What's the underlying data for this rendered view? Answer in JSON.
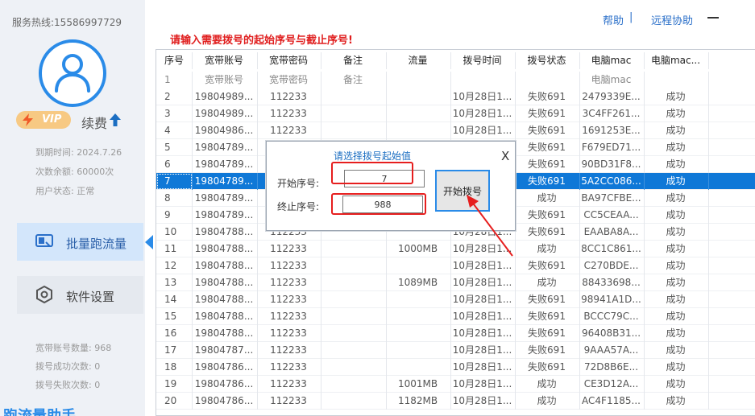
{
  "sidebar": {
    "hotline": "服务热线:15586997729",
    "vip_label": "VIP",
    "renew_label": "续费",
    "expire": "到期时间: 2024.7.26",
    "remaining": "次数余额: 60000次",
    "user_status": "用户状态: 正常",
    "nav_batch": "批量跑流量",
    "nav_settings": "软件设置",
    "stat_accounts": "宽带账号数量: 968",
    "stat_success": "拨号成功次数: 0",
    "stat_fail": "拨号失败次数: 0",
    "brand_partial": "跑流量助手"
  },
  "top": {
    "help": "帮助",
    "separator": "|",
    "remote": "远程协助"
  },
  "instruction": "请输入需要拨号的起始序号与截止序号!",
  "table": {
    "headers": [
      "序号",
      "宽带账号",
      "宽带密码",
      "备注",
      "流量",
      "拨号时间",
      "拨号状态",
      "电脑mac",
      "电脑mac..."
    ],
    "subheader": [
      "1",
      "宽带账号",
      "宽带密码",
      "备注",
      "",
      "",
      "",
      "电脑mac",
      ""
    ],
    "selected_index": 5,
    "rows": [
      [
        "2",
        "19804989...",
        "112233",
        "",
        "",
        "10月28日1...",
        "失败691",
        "2479339E...",
        "成功"
      ],
      [
        "3",
        "19804989...",
        "112233",
        "",
        "",
        "10月28日1...",
        "失败691",
        "3C4FF261...",
        "成功"
      ],
      [
        "4",
        "19804986...",
        "112233",
        "",
        "",
        "10月28日1...",
        "失败691",
        "1691253E...",
        "成功"
      ],
      [
        "5",
        "19804789...",
        "112233",
        "",
        "",
        "",
        "失败691",
        "F679ED71...",
        "成功"
      ],
      [
        "6",
        "19804789...",
        "112233",
        "",
        "",
        "",
        "失败691",
        "90BD31F8...",
        "成功"
      ],
      [
        "7",
        "19804789...",
        "112233",
        "",
        "",
        "",
        "失败691",
        "5A2CC086...",
        "成功"
      ],
      [
        "8",
        "19804789...",
        "112233",
        "",
        "",
        "",
        "成功",
        "BA97CFBE...",
        "成功"
      ],
      [
        "9",
        "19804789...",
        "112233",
        "",
        "",
        "",
        "失败691",
        "CC5CEAA...",
        "成功"
      ],
      [
        "10",
        "19804788...",
        "112233",
        "",
        "",
        "10月28日1...",
        "失败691",
        "EAABA8A...",
        "成功"
      ],
      [
        "11",
        "19804788...",
        "112233",
        "",
        "1000MB",
        "10月28日1...",
        "成功",
        "8CC1C861...",
        "成功"
      ],
      [
        "12",
        "19804788...",
        "112233",
        "",
        "",
        "10月28日1...",
        "失败691",
        "C270BDE...",
        "成功"
      ],
      [
        "13",
        "19804788...",
        "112233",
        "",
        "1089MB",
        "10月28日1...",
        "成功",
        "88433698...",
        "成功"
      ],
      [
        "14",
        "19804788...",
        "112233",
        "",
        "",
        "10月28日1...",
        "失败691",
        "98941A1D...",
        "成功"
      ],
      [
        "15",
        "19804788...",
        "112233",
        "",
        "",
        "10月28日1...",
        "失败691",
        "BCCC79C...",
        "成功"
      ],
      [
        "16",
        "19804788...",
        "112233",
        "",
        "",
        "10月28日1...",
        "失败691",
        "96408B31...",
        "成功"
      ],
      [
        "17",
        "19804787...",
        "112233",
        "",
        "",
        "10月28日1...",
        "失败691",
        "9AAA57A...",
        "成功"
      ],
      [
        "18",
        "19804786...",
        "112233",
        "",
        "",
        "10月28日1...",
        "失败691",
        "72D8B6E...",
        "成功"
      ],
      [
        "19",
        "19804786...",
        "112233",
        "",
        "1001MB",
        "10月28日1...",
        "成功",
        "CE3D12A...",
        "成功"
      ],
      [
        "20",
        "19804786...",
        "112233",
        "",
        "1182MB",
        "10月28日1...",
        "成功",
        "AC4F1185...",
        "成功"
      ]
    ]
  },
  "dialog": {
    "title": "请选择拨号起始值",
    "close": "X",
    "start_label": "开始序号:",
    "start_value": "7",
    "end_label": "终止序号:",
    "end_value": "988",
    "button": "开始拨号"
  },
  "colors": {
    "accent": "#2a8be8",
    "selection": "#0f78d7",
    "warning": "#e01e1e"
  }
}
